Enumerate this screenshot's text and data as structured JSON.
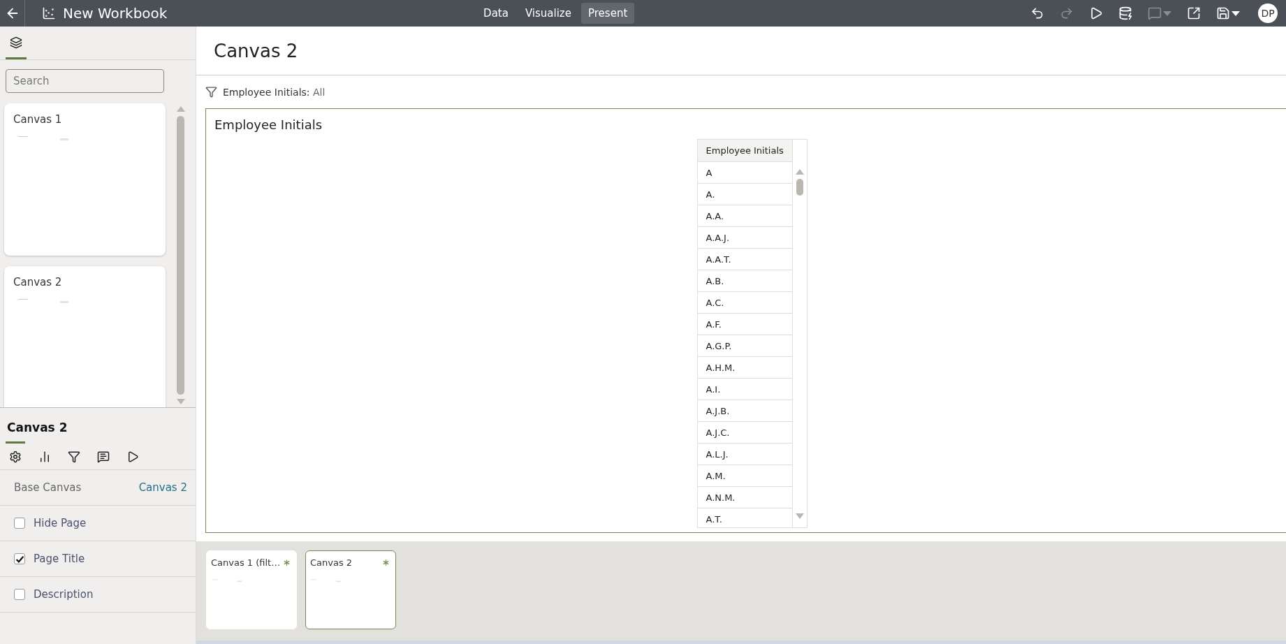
{
  "header": {
    "title": "New Workbook",
    "nav": [
      {
        "label": "Data",
        "selected": false
      },
      {
        "label": "Visualize",
        "selected": false
      },
      {
        "label": "Present",
        "selected": true
      }
    ],
    "toolbar": [
      {
        "kind": "undo",
        "disabled": false
      },
      {
        "kind": "redo",
        "disabled": true
      },
      {
        "kind": "play",
        "disabled": false
      },
      {
        "kind": "data",
        "disabled": false
      },
      {
        "kind": "comment",
        "disabled": true
      },
      {
        "kind": "export",
        "disabled": false
      },
      {
        "kind": "save",
        "disabled": false
      }
    ],
    "avatar": "DP"
  },
  "sidebar": {
    "tabs": [
      {
        "kind": "layers",
        "selected": true
      }
    ],
    "search": {
      "placeholder": "Search"
    },
    "canvases": [
      {
        "title": "Canvas 1"
      },
      {
        "title": "Canvas 2"
      }
    ]
  },
  "properties": {
    "title": "Canvas 2",
    "tabs": [
      {
        "kind": "settings",
        "selected": true
      },
      {
        "kind": "chart",
        "selected": false
      },
      {
        "kind": "filter",
        "selected": false
      },
      {
        "kind": "notes",
        "selected": false
      },
      {
        "kind": "play",
        "selected": false
      }
    ],
    "base_canvas": {
      "label": "Base Canvas",
      "value": "Canvas 2"
    },
    "options": [
      {
        "label": "Hide Page",
        "checked": false
      },
      {
        "label": "Page Title",
        "checked": true
      },
      {
        "label": "Description",
        "checked": false
      }
    ]
  },
  "canvas": {
    "title": "Canvas 2",
    "filter": {
      "label": "Employee Initials:",
      "value": "All"
    },
    "visualization": {
      "title": "Employee Initials",
      "column": "Employee Initials",
      "rows": [
        "A",
        "A.",
        "A.A.",
        "A.A.J.",
        "A.A.T.",
        "A.B.",
        "A.C.",
        "A.F.",
        "A.G.P.",
        "A.H.M.",
        "A.I.",
        "A.J.B.",
        "A.J.C.",
        "A.L.J.",
        "A.M.",
        "A.N.M.",
        "A.T."
      ]
    }
  },
  "pages": [
    {
      "title": "Canvas 1 (filt…",
      "selected": false
    },
    {
      "title": "Canvas 2",
      "selected": true
    }
  ]
}
